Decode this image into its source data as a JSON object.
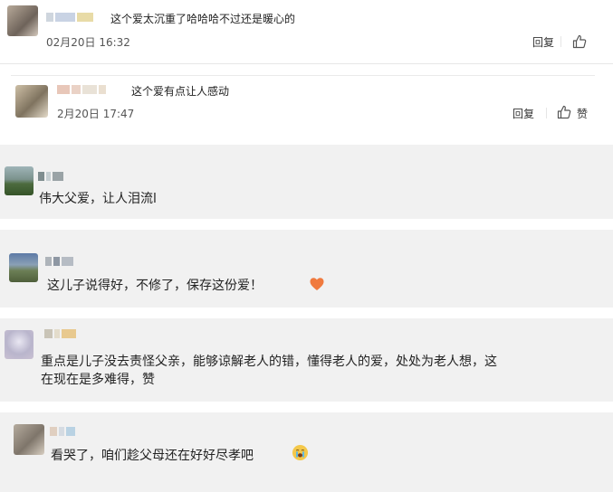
{
  "comments": [
    {
      "text": "这个爱太沉重了哈哈哈不过还是暖心的",
      "date": "02月20日 16:32",
      "reply": "回复",
      "like": ""
    },
    {
      "text": "这个爱有点让人感动",
      "date": "2月20日 17:47",
      "reply": "回复",
      "like": "赞"
    },
    {
      "text": "伟大父爱，让人泪流l"
    },
    {
      "text": "这儿子说得好，不修了，保存这份爱！",
      "emoji": "heart"
    },
    {
      "text_line1": "重点是儿子没去责怪父亲，能够谅解老人的错，懂得老人的爱，处处为老人想，这",
      "text_line2": "在现在是多难得，赞"
    },
    {
      "text": "看哭了，咱们趁父母还在好好尽孝吧",
      "emoji": "crying-face"
    }
  ]
}
